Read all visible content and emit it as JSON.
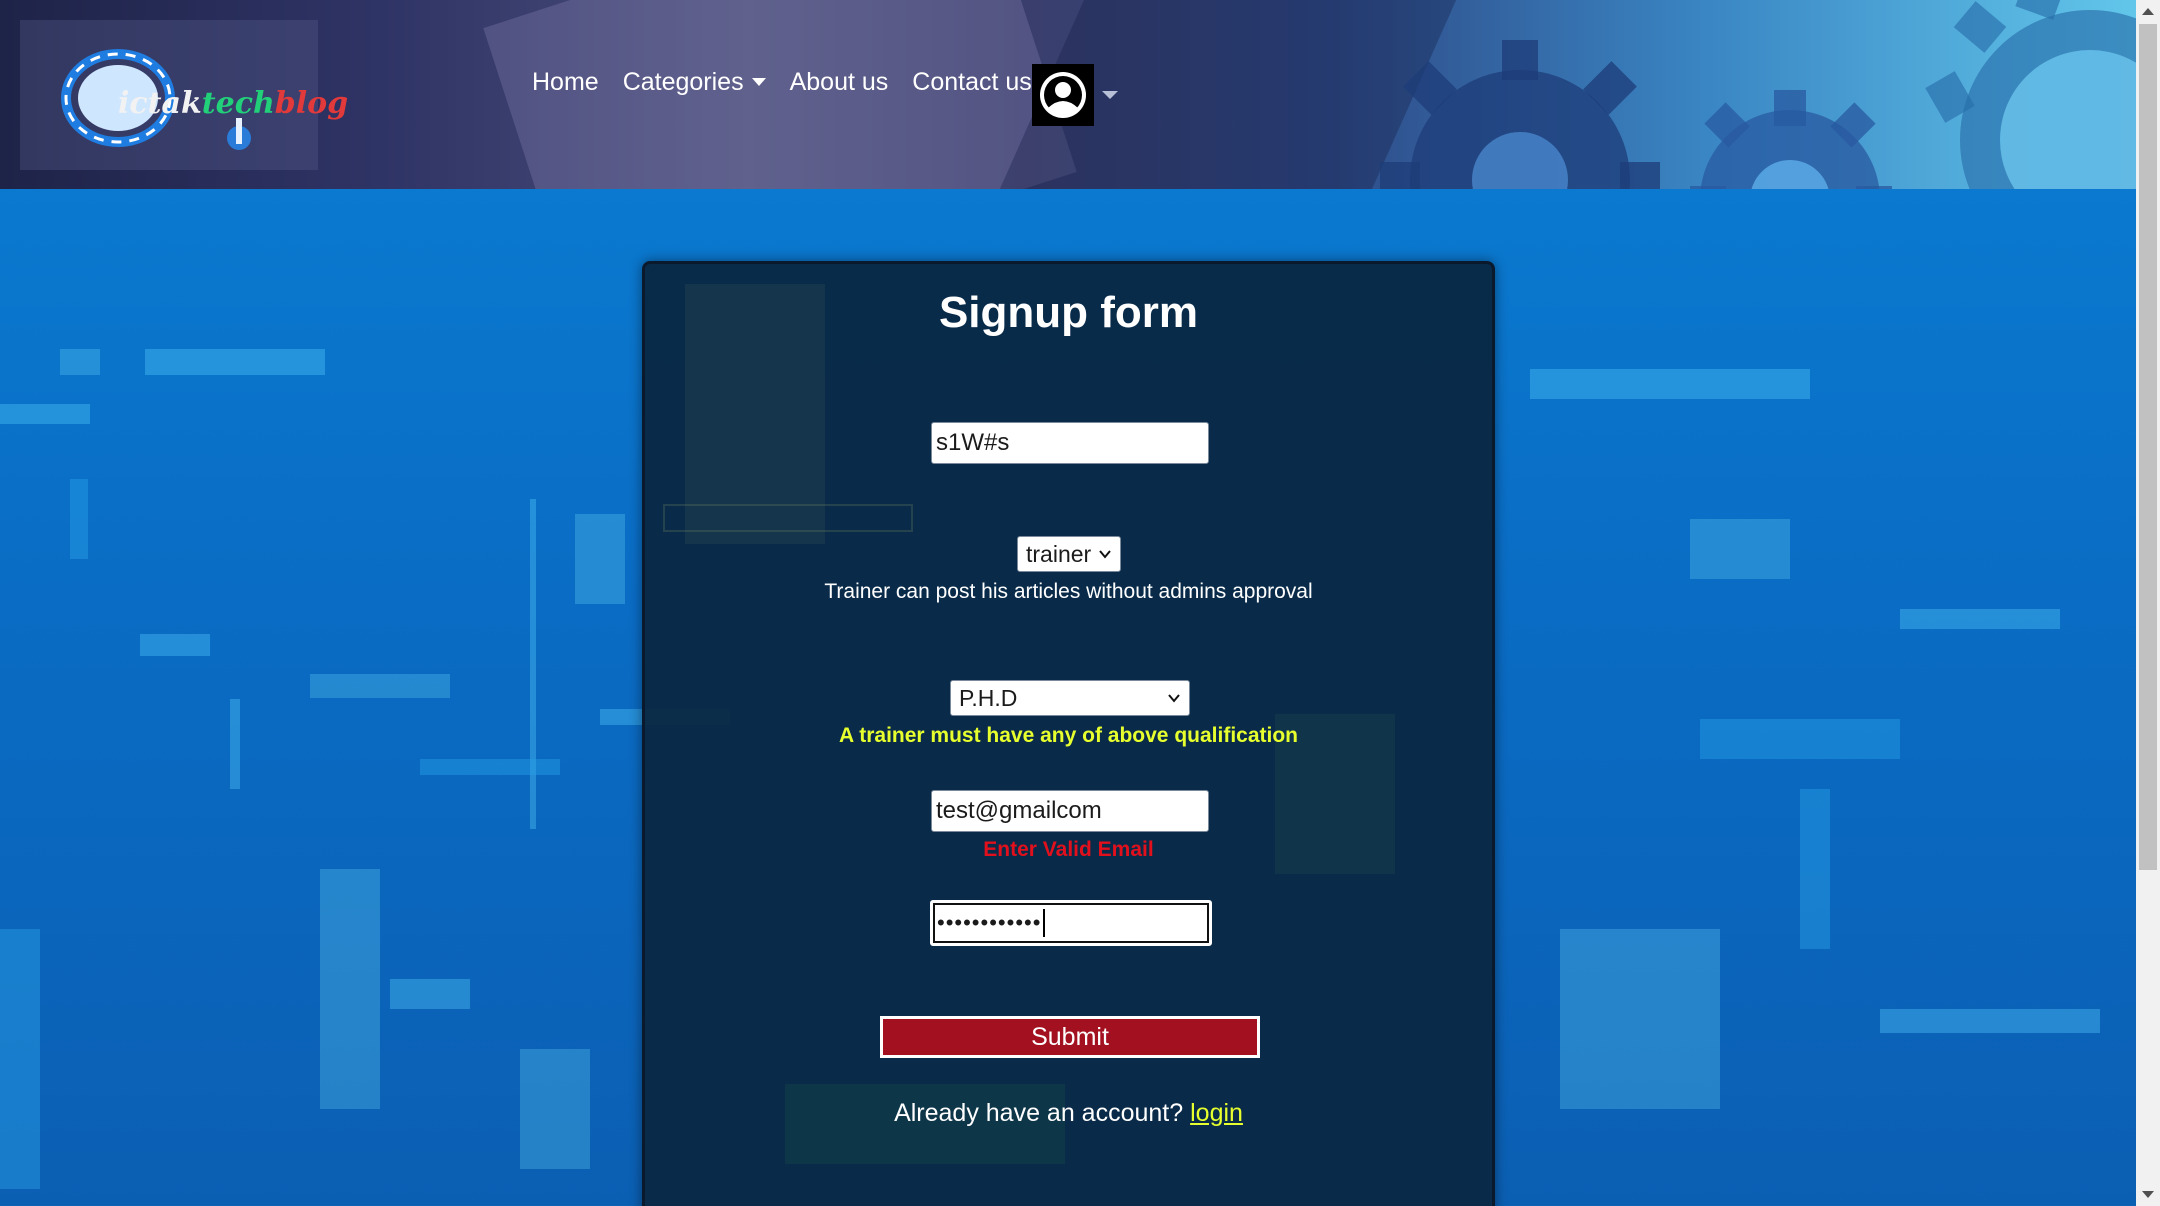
{
  "header": {
    "logo": {
      "text_part1": "ictak",
      "text_part2": "tech",
      "text_part3": "blog"
    },
    "nav": {
      "home": "Home",
      "categories": "Categories",
      "about": "About us",
      "contact": "Contact us"
    },
    "profile_icon": "user-circle-icon"
  },
  "form": {
    "title": "Signup form",
    "username_value": "s1W#s",
    "role": {
      "selected": "trainer"
    },
    "role_hint": "Trainer can post his articles without admins approval",
    "qualification": {
      "selected": "P.H.D"
    },
    "qualification_hint": "A trainer must have any of above qualification",
    "email_value": "test@gmailcom",
    "email_error": "Enter Valid Email",
    "password_value": "••••••••••••",
    "submit_label": "Submit",
    "login_prompt": "Already have an account?",
    "login_link": "login"
  },
  "colors": {
    "submit_bg": "#a3101f",
    "warning_yellow": "#e8ff2e",
    "error_red": "#e2101c",
    "card_bg": "#0a2640"
  }
}
